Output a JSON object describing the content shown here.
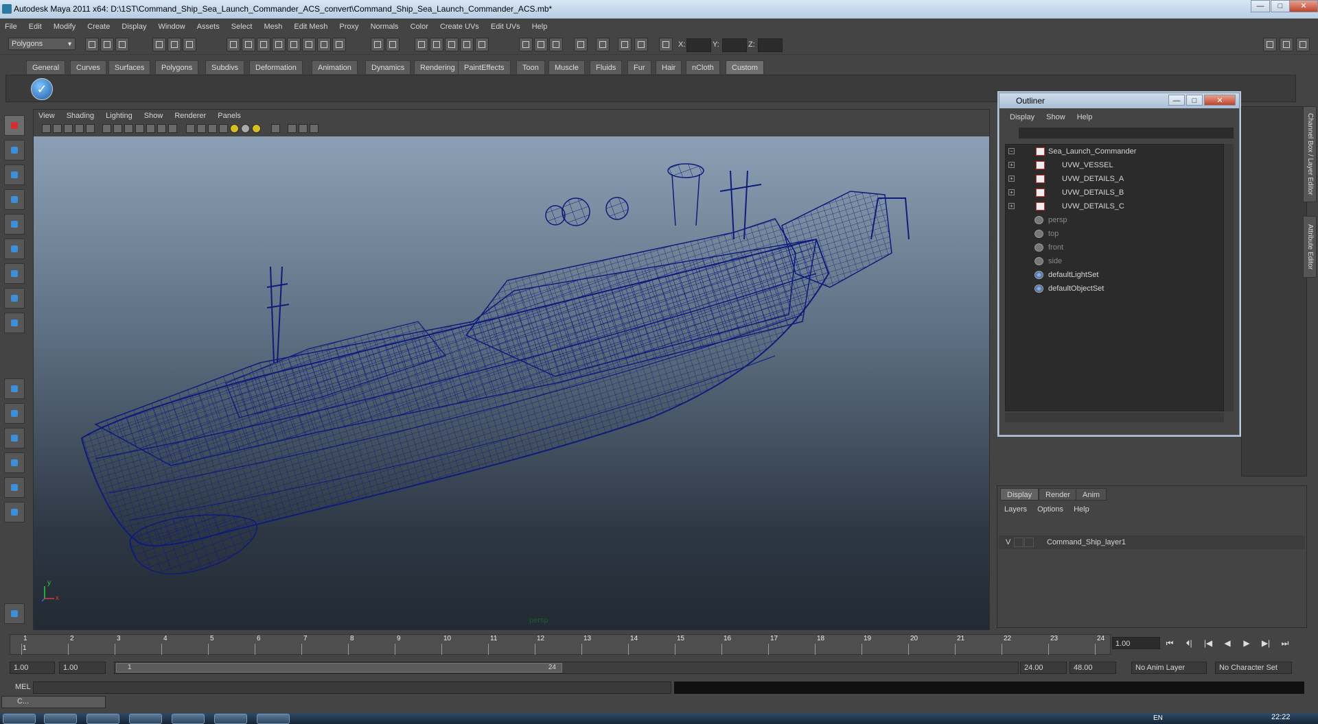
{
  "window": {
    "title": "Autodesk Maya 2011 x64: D:\\1ST\\Command_Ship_Sea_Launch_Commander_ACS_convert\\Command_Ship_Sea_Launch_Commander_ACS.mb*",
    "minimize": "—",
    "maximize": "□",
    "close": "✕"
  },
  "menubar": [
    "File",
    "Edit",
    "Modify",
    "Create",
    "Display",
    "Window",
    "Assets",
    "Select",
    "Mesh",
    "Edit Mesh",
    "Proxy",
    "Normals",
    "Color",
    "Create UVs",
    "Edit UVs",
    "Help"
  ],
  "statusline": {
    "mode_selector": "Polygons",
    "x_label": "X:",
    "y_label": "Y:",
    "z_label": "Z:"
  },
  "shelf_tabs": [
    "General",
    "Curves",
    "Surfaces",
    "Polygons",
    "Subdivs",
    "Deformation",
    "Animation",
    "Dynamics",
    "Rendering",
    "PaintEffects",
    "Toon",
    "Muscle",
    "Fluids",
    "Fur",
    "Hair",
    "nCloth",
    "Custom"
  ],
  "shelf_active_tab": "Custom",
  "viewport": {
    "menu": [
      "View",
      "Shading",
      "Lighting",
      "Show",
      "Renderer",
      "Panels"
    ],
    "camera_label": "persp",
    "axis_y": "y",
    "axis_x": "x"
  },
  "outliner": {
    "title": "Outliner",
    "menu": [
      "Display",
      "Show",
      "Help"
    ],
    "items": [
      {
        "label": "Sea_Launch_Commander",
        "kind": "mesh",
        "expander": "−"
      },
      {
        "label": "UVW_VESSEL",
        "kind": "mesh",
        "expander": "+"
      },
      {
        "label": "UVW_DETAILS_A",
        "kind": "mesh",
        "expander": "+"
      },
      {
        "label": "UVW_DETAILS_B",
        "kind": "mesh",
        "expander": "+"
      },
      {
        "label": "UVW_DETAILS_C",
        "kind": "mesh",
        "expander": "+"
      },
      {
        "label": "persp",
        "kind": "camera",
        "expander": ""
      },
      {
        "label": "top",
        "kind": "camera",
        "expander": ""
      },
      {
        "label": "front",
        "kind": "camera",
        "expander": ""
      },
      {
        "label": "side",
        "kind": "camera",
        "expander": ""
      },
      {
        "label": "defaultLightSet",
        "kind": "set",
        "expander": ""
      },
      {
        "label": "defaultObjectSet",
        "kind": "set",
        "expander": ""
      }
    ]
  },
  "side_tabs": {
    "channel_box": "Channel Box / Layer Editor",
    "attribute_editor": "Attribute Editor"
  },
  "layer_editor": {
    "tabs": [
      "Display",
      "Render",
      "Anim"
    ],
    "menu": [
      "Layers",
      "Options",
      "Help"
    ],
    "layer": {
      "visible": "V",
      "name": "Command_Ship_layer1"
    }
  },
  "time_slider": {
    "ticks": [
      "1",
      "2",
      "3",
      "4",
      "5",
      "6",
      "7",
      "8",
      "9",
      "10",
      "11",
      "12",
      "13",
      "14",
      "15",
      "16",
      "17",
      "18",
      "19",
      "20",
      "21",
      "22",
      "23",
      "24"
    ],
    "current_marker": "1",
    "current_frame": "1.00",
    "buttons": [
      "⏮",
      "⏴|",
      "|◀",
      "◀",
      "▶",
      "▶|",
      "⏭"
    ]
  },
  "range_slider": {
    "start": "1.00",
    "playback_start": "1.00",
    "range_start_label": "1",
    "range_end_label": "24",
    "playback_end": "24.00",
    "end": "48.00",
    "anim_layer": "No Anim Layer",
    "character_set": "No Character Set"
  },
  "command_line": {
    "label": "MEL"
  },
  "taskbar": {
    "clock": "22:22",
    "lang": "EN",
    "minimized_window": "C..."
  },
  "colors": {
    "wireframe": "#0d1b7a",
    "ui_bg": "#444444",
    "active_tab": "#6e6e6e"
  }
}
